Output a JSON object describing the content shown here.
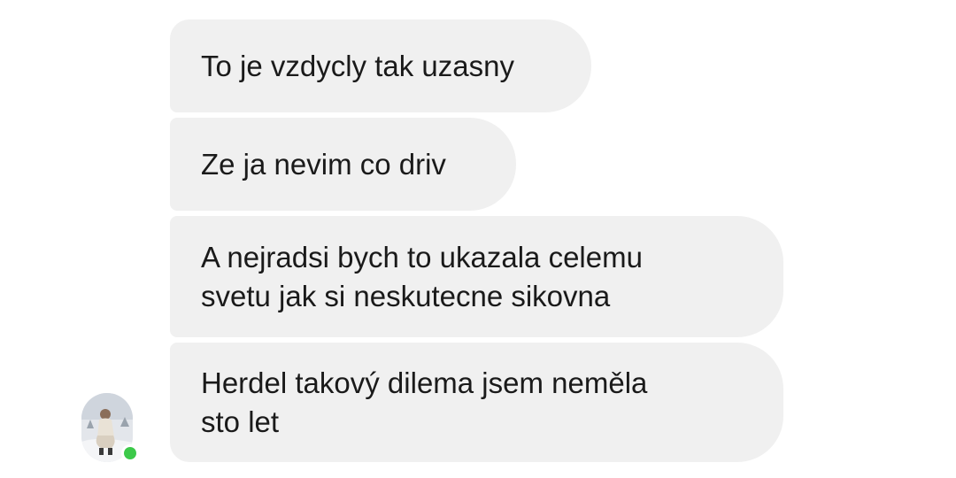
{
  "messages": [
    {
      "text": "To je vzdycly tak uzasny"
    },
    {
      "text": "Ze ja nevim co driv"
    },
    {
      "text": "A nejradsi bych to ukazala celemu\nsvetu jak si neskutecne sikovna"
    },
    {
      "text": "Herdel takový dilema jsem neměla\nsto let"
    }
  ],
  "sender": {
    "online": true,
    "status_color": "#3cc94a"
  },
  "colors": {
    "bubble_bg": "#f0f0f0",
    "text": "#1a1a1a",
    "background": "#ffffff"
  }
}
